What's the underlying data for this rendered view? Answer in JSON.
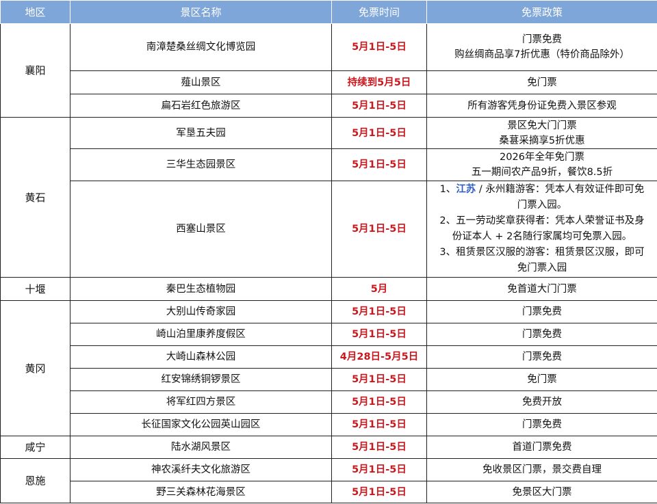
{
  "headers": [
    "地区",
    "景区名称",
    "免票时间",
    "免票政策"
  ],
  "rows": [
    {
      "region": "襄阳",
      "name": "南漳楚桑丝绸文化博览园",
      "date": "5月1日-5日",
      "policy": [
        "门票免费",
        "购丝绸商品享7折优惠（特价商品除外）"
      ]
    },
    {
      "name": "薤山景区",
      "date": "持续到5月5日",
      "policy": [
        "免门票"
      ]
    },
    {
      "name": "扁石岩红色旅游区",
      "date": "5月1日-5日",
      "policy": [
        "所有游客凭身份证免费入景区参观"
      ]
    },
    {
      "region": "黄石",
      "name": "军垦五夫园",
      "date": "5月1日-5日",
      "policy": [
        "景区免大门门票",
        "桑葚采摘享5折优惠"
      ]
    },
    {
      "name": "三华生态园景区",
      "date": "5月1日-5日",
      "policy": [
        "2026年全年免门票",
        "五一期间农产品9折，餐饮8.5折"
      ]
    },
    {
      "name": "西塞山景区",
      "date": "5月1日-5日",
      "policy_rich": {
        "p1_prefix": "1、",
        "p1_highlight": "江苏",
        "p1_rest_a": " / 永州籍游客：凭本人有效证件即可免",
        "p1_rest_b": "门票入园。",
        "p2_a": "2、五一劳动奖章获得者：凭本人荣誉证书及身",
        "p2_b": "份证本人 + 2名随行家属均可免票入园。",
        "p3_a": "3、租赁景区汉服的游客：租赁景区汉服，即可",
        "p3_b": "免门票入园"
      }
    },
    {
      "region": "十堰",
      "name": "秦巴生态植物园",
      "date": "5月",
      "policy": [
        "免首道大门门票"
      ]
    },
    {
      "region": "黄冈",
      "name": "大别山传奇家园",
      "date": "5月1日-5日",
      "policy": [
        "门票免费"
      ]
    },
    {
      "name": "崎山泊里康养度假区",
      "date": "5月1日-5日",
      "policy": [
        "门票免费"
      ]
    },
    {
      "name": "大崎山森林公园",
      "date": "4月28日-5月5日",
      "policy": [
        "门票免费"
      ]
    },
    {
      "name": "红安锦绣铜锣景区",
      "date": "5月1日-5日",
      "policy": [
        "免门票"
      ]
    },
    {
      "name": "将军红四方景区",
      "date": "5月1日-5日",
      "policy": [
        "免费开放"
      ]
    },
    {
      "name": "长征国家文化公园英山园区",
      "date": "5月1日-5日",
      "policy": [
        "门票免费"
      ]
    },
    {
      "region": "咸宁",
      "name": "陆水湖风景区",
      "date": "5月1日-5日",
      "policy": [
        "首道门票免费"
      ]
    },
    {
      "region": "恩施",
      "name": "神农溪纤夫文化旅游区",
      "date": "5月1日-5日",
      "policy": [
        "免收景区门票，景交费自理"
      ]
    },
    {
      "name": "野三关森林花海景区",
      "date": "5月1日-5日",
      "policy": [
        "免景区大门票"
      ]
    }
  ],
  "colors": {
    "header_bg": "#7ea6d8",
    "date_red": "#c8181e",
    "highlight_blue": "#2f5fbf"
  }
}
